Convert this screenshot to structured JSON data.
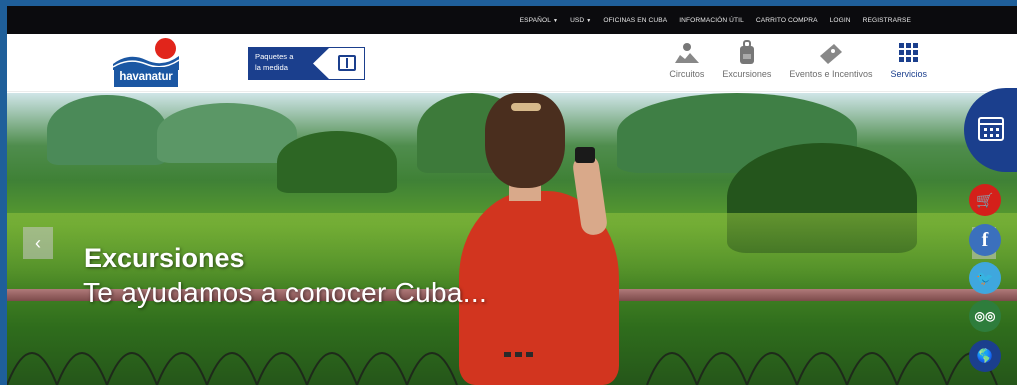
{
  "topnav": {
    "language": "ESPAÑOL",
    "currency": "USD",
    "links": [
      "OFICINAS EN CUBA",
      "INFORMACIÓN ÚTIL",
      "CARRITO COMPRA",
      "LOGIN",
      "REGISTRARSE"
    ]
  },
  "brand": {
    "logo_text": "havanatur"
  },
  "promo": {
    "line1": "Paquetes a",
    "line2": "la medida"
  },
  "mainnav": [
    {
      "label": "Circuitos",
      "icon": "map-icon"
    },
    {
      "label": "Excursiones",
      "icon": "backpack-icon"
    },
    {
      "label": "Eventos e Incentivos",
      "icon": "ticket-icon"
    },
    {
      "label": "Servicios",
      "icon": "grid-icon"
    }
  ],
  "hero": {
    "title": "Excursiones",
    "subtitle": "Te ayudamos a conocer Cuba..."
  },
  "colors": {
    "brand_blue": "#1b3f8d",
    "accent_red": "#d4201a",
    "topbar": "#0b0b0e"
  }
}
